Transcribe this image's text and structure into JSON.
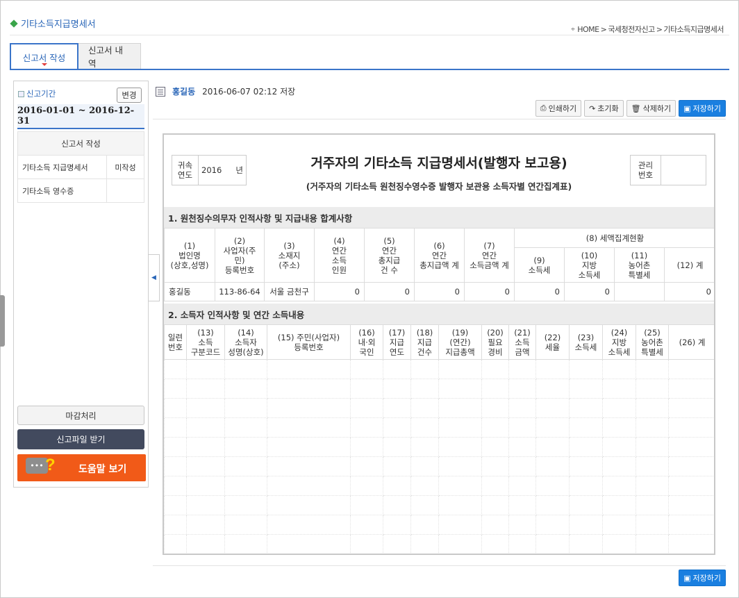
{
  "page": {
    "title": "기타소득지급명세서",
    "breadcrumb": [
      "HOME",
      "국세청전자신고",
      "기타소득지급명세서"
    ]
  },
  "tabs": [
    {
      "label": "신고서 작성",
      "active": true
    },
    {
      "label": "신고서 내역",
      "active": false
    }
  ],
  "sidebar": {
    "period_label": "신고기간",
    "change_button": "변경",
    "period_range": "2016-01-01 ~ 2016-12-31",
    "table_header": "신고서 작성",
    "rows": [
      {
        "label": "기타소득 지급명세서",
        "status": "미작성"
      },
      {
        "label": "기타소득 영수증",
        "status": ""
      }
    ],
    "close_button": "마감처리",
    "file_button": "신고파일 받기",
    "help_button": "도움말 보기"
  },
  "content": {
    "author": "홍길동",
    "saved_at": "2016-06-07 02:12 저장",
    "toolbar": {
      "print": "인쇄하기",
      "reset": "초기화",
      "delete": "삭제하기",
      "save": "저장하기"
    }
  },
  "form": {
    "title": "거주자의 기타소득 지급명세서(발행자 보고용)",
    "subtitle": "(거주자의 기타소득 원천징수영수증 발행자 보관용 소득자별 연간집계표)",
    "year_label_1": "귀속",
    "year_label_2": "연도",
    "year_value": "2016",
    "year_unit": "년",
    "mgmt_label_1": "관리",
    "mgmt_label_2": "번호",
    "section1": {
      "title": "1. 원천징수의무자 인적사항 및 지급내용 합계사항",
      "headers": {
        "c1": [
          "(1)",
          "법인명",
          "(상호,성명)"
        ],
        "c2": [
          "(2)",
          "사업자(주",
          "민)",
          "등록번호"
        ],
        "c3": [
          "(3)",
          "소재지",
          "(주소)"
        ],
        "c4": [
          "(4)",
          "연간",
          "소득",
          "인원"
        ],
        "c5": [
          "(5)",
          "연간",
          "총지급",
          "건 수"
        ],
        "c6": [
          "(6)",
          "연간",
          "총지급액 계"
        ],
        "c7": [
          "(7)",
          "연간",
          "소득금액 계"
        ],
        "c8": "(8) 세액집계현황",
        "c9": [
          "(9)",
          "소득세"
        ],
        "c10": [
          "(10)",
          "지방",
          "소득세"
        ],
        "c11": [
          "(11)",
          "농어촌",
          "특별세"
        ],
        "c12": "(12) 계"
      },
      "row": {
        "name": "홍길동",
        "biz_no": "113-86-64",
        "address": "서울 금천구",
        "people": "0",
        "count": "0",
        "total_paid": "0",
        "total_income": "0",
        "income_tax": "0",
        "local_tax": "0",
        "rural_tax": "",
        "sum": "0"
      }
    },
    "section2": {
      "title": "2. 소득자 인적사항 및 연간 소득내용",
      "headers": {
        "h0": [
          "일련",
          "번호"
        ],
        "h13": [
          "(13)",
          "소득",
          "구분코드"
        ],
        "h14": [
          "(14)",
          "소득자",
          "성명(상호)"
        ],
        "h15": [
          "(15) 주민(사업자)",
          "등록번호"
        ],
        "h16": [
          "(16)",
          "내·외",
          "국인"
        ],
        "h17": [
          "(17)",
          "지급",
          "연도"
        ],
        "h18": [
          "(18)",
          "지급",
          "건수"
        ],
        "h19": [
          "(19)",
          "(연간)",
          "지급총액"
        ],
        "h20": [
          "(20)",
          "필요",
          "경비"
        ],
        "h21": [
          "(21)",
          "소득",
          "금액"
        ],
        "h22": [
          "(22)",
          "세율"
        ],
        "h23": [
          "(23)",
          "소득세"
        ],
        "h24": [
          "(24)",
          "지방",
          "소득세"
        ],
        "h25": [
          "(25)",
          "농어촌",
          "특별세"
        ],
        "h26": "(26) 계"
      }
    }
  },
  "colors": {
    "accent": "#3a74c9",
    "link": "#2a66b8",
    "save_button": "#1a7fe0",
    "help_button": "#f15a18",
    "file_button": "#424a5e"
  }
}
